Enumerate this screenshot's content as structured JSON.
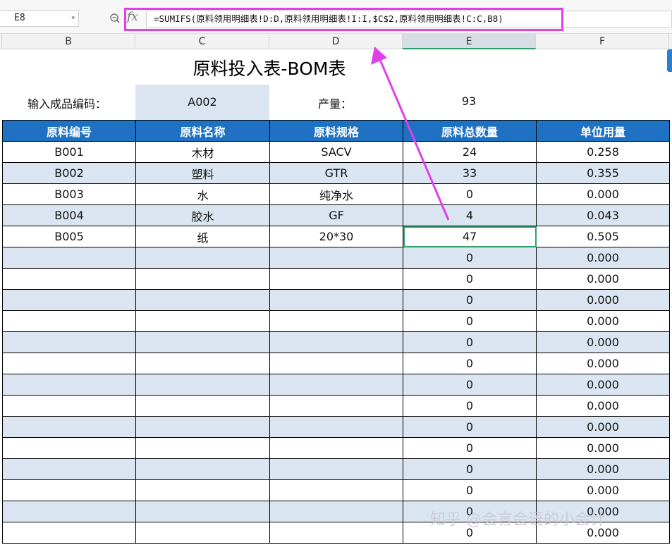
{
  "formula_bar": {
    "cell_ref": "E8",
    "fx_symbol": "fx",
    "formula": "=SUMIFS(原料领用明细表!D:D,原料领用明细表!I:I,$C$2,原料领用明细表!C:C,B8)"
  },
  "columns": [
    "B",
    "C",
    "D",
    "E",
    "F"
  ],
  "selected_column": "E",
  "sheet": {
    "title": "原料投入表-BOM表",
    "product_code_label": "输入成品编码：",
    "product_code": "A002",
    "output_label": "产量：",
    "output_value": "93"
  },
  "table": {
    "headers": [
      "原料编号",
      "原料名称",
      "原料规格",
      "原料总数量",
      "单位用量"
    ],
    "rows": [
      [
        "B001",
        "木材",
        "SACV",
        "24",
        "0.258"
      ],
      [
        "B002",
        "塑料",
        "GTR",
        "33",
        "0.355"
      ],
      [
        "B003",
        "水",
        "纯净水",
        "0",
        "0.000"
      ],
      [
        "B004",
        "胶水",
        "GF",
        "4",
        "0.043"
      ],
      [
        "B005",
        "纸",
        "20*30",
        "47",
        "0.505"
      ],
      [
        "",
        "",
        "",
        "0",
        "0.000"
      ],
      [
        "",
        "",
        "",
        "0",
        "0.000"
      ],
      [
        "",
        "",
        "",
        "0",
        "0.000"
      ],
      [
        "",
        "",
        "",
        "0",
        "0.000"
      ],
      [
        "",
        "",
        "",
        "0",
        "0.000"
      ],
      [
        "",
        "",
        "",
        "0",
        "0.000"
      ],
      [
        "",
        "",
        "",
        "0",
        "0.000"
      ],
      [
        "",
        "",
        "",
        "0",
        "0.000"
      ],
      [
        "",
        "",
        "",
        "0",
        "0.000"
      ],
      [
        "",
        "",
        "",
        "0",
        "0.000"
      ],
      [
        "",
        "",
        "",
        "0",
        "0.000"
      ],
      [
        "",
        "",
        "",
        "0",
        "0.000"
      ],
      [
        "",
        "",
        "",
        "0",
        "0.000"
      ],
      [
        "",
        "",
        "",
        "0",
        "0.000"
      ]
    ],
    "active_row_index": 4,
    "active_col_index": 3
  },
  "watermark": "知乎 @会言会语的小会计",
  "colors": {
    "header_bg": "#1f72c3",
    "alt_row_bg": "#dbe5f1",
    "highlight": "#e040e8",
    "active_cell": "#2fa36b"
  }
}
